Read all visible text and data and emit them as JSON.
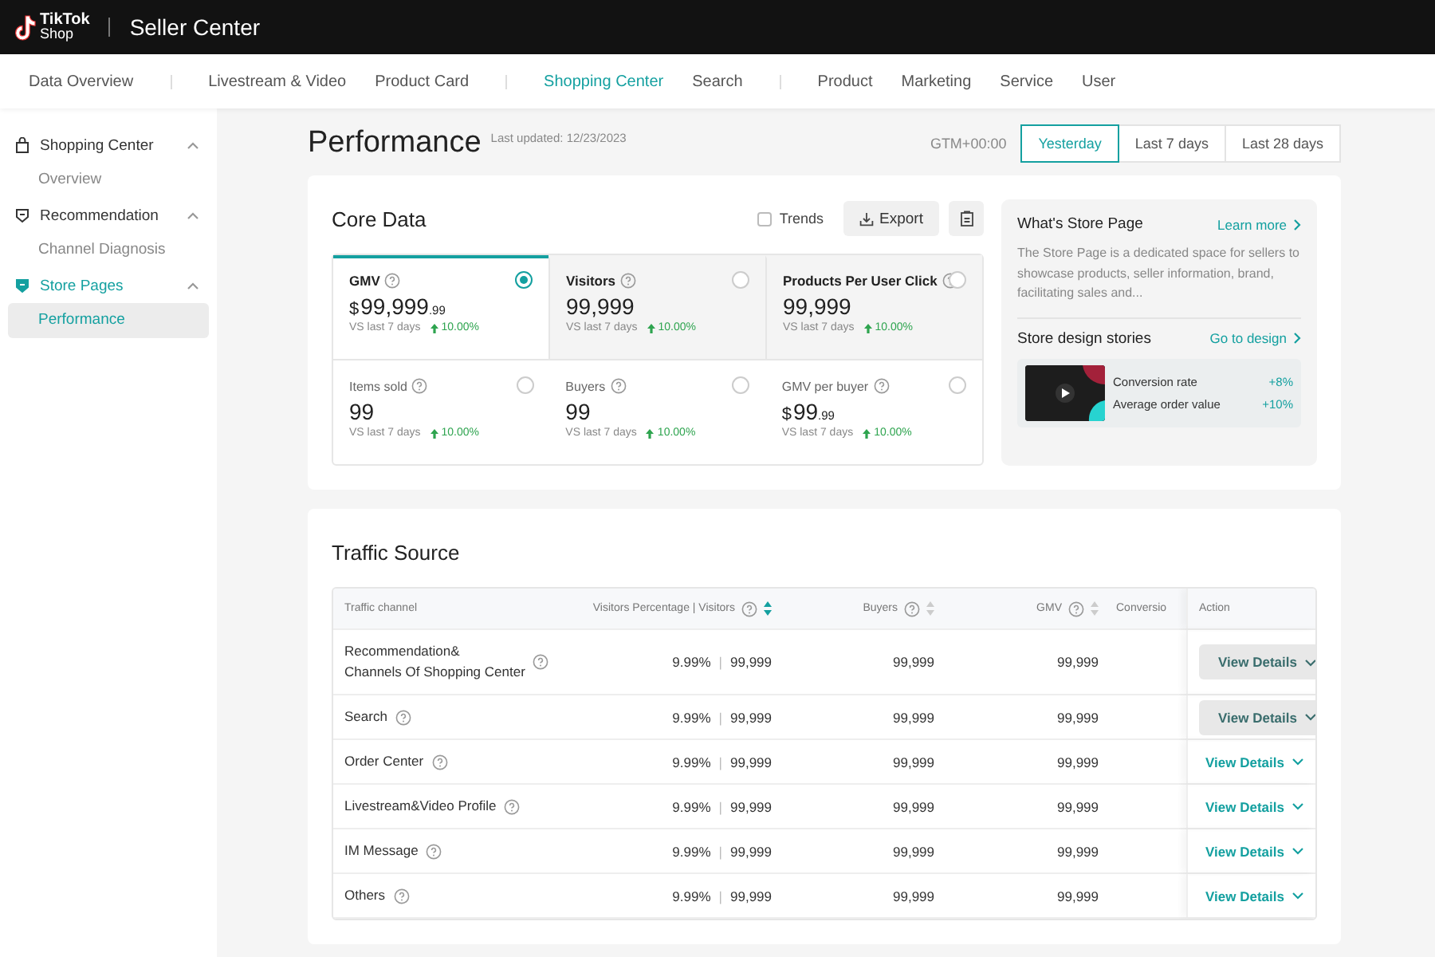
{
  "header": {
    "logo_line1": "TikTok",
    "logo_line2": "Shop",
    "title": "Seller Center"
  },
  "nav": {
    "groups": [
      [
        {
          "label": "Data Overview",
          "selected": false
        }
      ],
      [
        {
          "label": "Livestream & Video",
          "selected": false
        },
        {
          "label": "Product Card",
          "selected": false
        }
      ],
      [
        {
          "label": "Shopping Center",
          "selected": true
        },
        {
          "label": "Search",
          "selected": false
        }
      ],
      [
        {
          "label": "Product",
          "selected": false
        },
        {
          "label": "Marketing",
          "selected": false
        },
        {
          "label": "Service",
          "selected": false
        },
        {
          "label": "User",
          "selected": false
        }
      ]
    ]
  },
  "sidebar": {
    "groups": [
      {
        "label": "Shopping Center",
        "active": false,
        "expanded": true,
        "children": [
          {
            "label": "Overview",
            "selected": false
          }
        ]
      },
      {
        "label": "Recommendation",
        "active": false,
        "expanded": true,
        "children": [
          {
            "label": "Channel Diagnosis",
            "selected": false
          }
        ]
      },
      {
        "label": "Store Pages",
        "active": true,
        "expanded": true,
        "children": [
          {
            "label": "Performance",
            "selected": true
          }
        ]
      }
    ]
  },
  "page": {
    "title": "Performance",
    "last_updated": "Last updated: 12/23/2023",
    "timezone": "GTM+00:00",
    "ranges": [
      {
        "label": "Yesterday",
        "selected": true
      },
      {
        "label": "Last 7 days",
        "selected": false
      },
      {
        "label": "Last 28 days",
        "selected": false
      }
    ]
  },
  "core_data": {
    "title": "Core Data",
    "trends": {
      "label": "Trends",
      "checked": false
    },
    "export_label": "Export",
    "metric_rows": [
      {
        "shaded": true,
        "metrics": [
          {
            "label": "GMV",
            "currency": "$",
            "value": "99,999",
            "decimals": ".99",
            "compare": "VS last 7 days",
            "change": "10.00%",
            "selected": true
          },
          {
            "label": "Visitors",
            "value": "99,999",
            "compare": "VS last 7 days",
            "change": "10.00%",
            "selected": false
          },
          {
            "label": "Products Per User Click",
            "value": "99,999",
            "compare": "VS last 7 days",
            "change": "10.00%",
            "selected": false
          }
        ]
      },
      {
        "shaded": false,
        "metrics": [
          {
            "label": "Items sold",
            "value": "99",
            "compare": "VS last 7 days",
            "change": "10.00%",
            "selected": false
          },
          {
            "label": "Buyers",
            "value": "99",
            "compare": "VS last 7 days",
            "change": "10.00%",
            "selected": false
          },
          {
            "label": "GMV per buyer",
            "currency": "$",
            "value": "99",
            "decimals": ".99",
            "compare": "VS last 7 days",
            "change": "10.00%",
            "selected": false
          }
        ]
      }
    ]
  },
  "store_panel": {
    "title": "What's Store Page",
    "learn_more": "Learn more",
    "description": "The Store Page is a dedicated space for sellers to showcase products, seller information, brand, facilitating sales and...",
    "stories_title": "Store design stories",
    "go_to_design": "Go to design",
    "stats": [
      {
        "label": "Conversion rate",
        "value": "+8%"
      },
      {
        "label": "Average order value",
        "value": "+10%"
      }
    ]
  },
  "traffic": {
    "title": "Traffic Source",
    "columns": [
      {
        "label": "Traffic channel",
        "kind": "plain"
      },
      {
        "label": "Visitors Percentage | Visitors",
        "kind": "sorted"
      },
      {
        "label": "Buyers",
        "kind": "sortable"
      },
      {
        "label": "GMV",
        "kind": "sortable"
      },
      {
        "label": "Conversio",
        "kind": "plain"
      },
      {
        "label": "Action",
        "kind": "plain"
      }
    ],
    "rows": [
      {
        "channel": "Recommendation&\nChannels Of Shopping Center",
        "visitors_pct": "9.99%",
        "separator": "|",
        "visitors": "99,999",
        "buyers": "99,999",
        "gmv": "99,999",
        "action": "View Details",
        "highlighted": true
      },
      {
        "channel": "Search",
        "visitors_pct": "9.99%",
        "separator": "|",
        "visitors": "99,999",
        "buyers": "99,999",
        "gmv": "99,999",
        "action": "View Details",
        "highlighted": true
      },
      {
        "channel": "Order Center",
        "visitors_pct": "9.99%",
        "separator": "|",
        "visitors": "99,999",
        "buyers": "99,999",
        "gmv": "99,999",
        "action": "View Details",
        "highlighted": false
      },
      {
        "channel": "Livestream&Video Profile",
        "visitors_pct": "9.99%",
        "separator": "|",
        "visitors": "99,999",
        "buyers": "99,999",
        "gmv": "99,999",
        "action": "View Details",
        "highlighted": false
      },
      {
        "channel": "IM Message",
        "visitors_pct": "9.99%",
        "separator": "|",
        "visitors": "99,999",
        "buyers": "99,999",
        "gmv": "99,999",
        "action": "View Details",
        "highlighted": false
      },
      {
        "channel": "Others",
        "visitors_pct": "9.99%",
        "separator": "|",
        "visitors": "99,999",
        "buyers": "99,999",
        "gmv": "99,999",
        "action": "View Details",
        "highlighted": false
      }
    ]
  }
}
